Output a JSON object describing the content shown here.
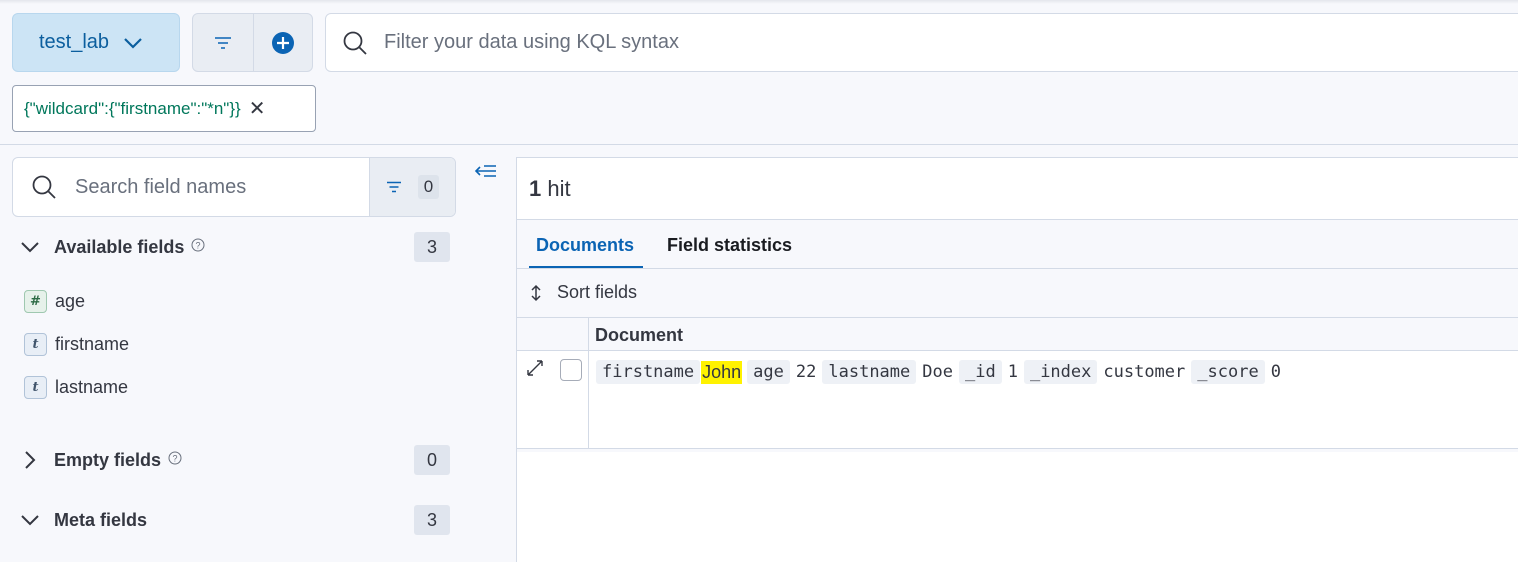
{
  "header": {
    "data_view": "test_lab",
    "query_placeholder": "Filter your data using KQL syntax"
  },
  "filter_pill": {
    "label": "{\"wildcard\":{\"firstname\":\"*n\"}}"
  },
  "sidebar": {
    "search_placeholder": "Search field names",
    "filter_count": "0",
    "available_fields": {
      "title": "Available fields",
      "count": "3"
    },
    "fields": [
      {
        "type": "#",
        "name": "age"
      },
      {
        "type": "t",
        "name": "firstname"
      },
      {
        "type": "t",
        "name": "lastname"
      }
    ],
    "empty_fields": {
      "title": "Empty fields",
      "count": "0"
    },
    "meta_fields": {
      "title": "Meta fields",
      "count": "3"
    }
  },
  "main": {
    "hit_count": "1",
    "hit_label": "hit",
    "tabs": {
      "documents": "Documents",
      "field_statistics": "Field statistics"
    },
    "sort_label": "Sort fields",
    "column_header": "Document",
    "row": [
      {
        "key": "firstname",
        "value": "John",
        "highlight": true
      },
      {
        "key": "age",
        "value": "22"
      },
      {
        "key": "lastname",
        "value": "Doe"
      },
      {
        "key": "_id",
        "value": "1"
      },
      {
        "key": "_index",
        "value": "customer"
      },
      {
        "key": "_score",
        "value": "0"
      }
    ]
  },
  "colors": {
    "accent": "#0b64b4",
    "highlight": "#fff200",
    "dataview_bg": "#cce4f5"
  }
}
